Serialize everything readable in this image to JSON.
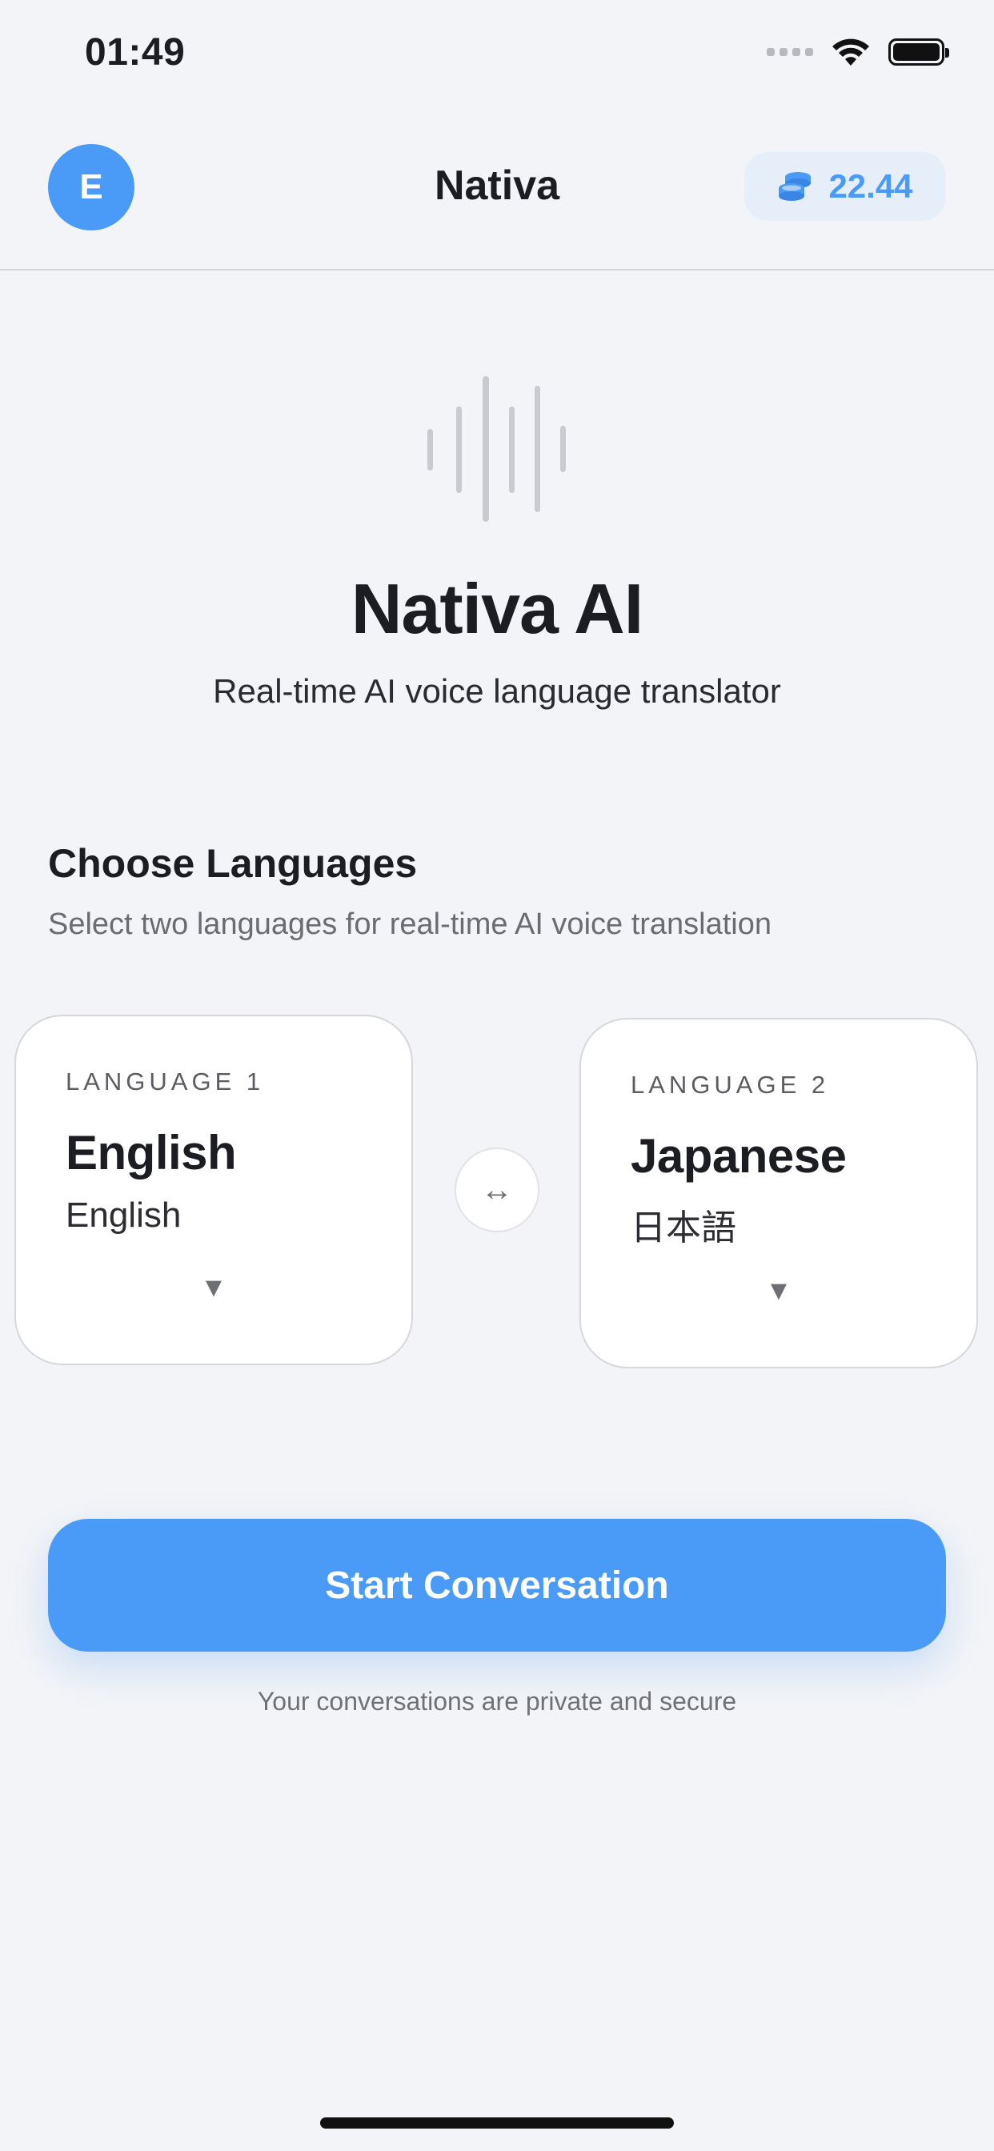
{
  "status_bar": {
    "time": "01:49",
    "signal_icon": "cellular-dots-icon",
    "wifi_icon": "wifi-icon",
    "battery_icon": "battery-icon"
  },
  "header": {
    "avatar_initial": "E",
    "title": "Nativa",
    "credits_icon": "coins-stack-icon",
    "credits_value": "22.44"
  },
  "hero": {
    "icon": "sound-wave-icon",
    "title": "Nativa AI",
    "subtitle": "Real-time AI voice language translator"
  },
  "languages_section": {
    "title": "Choose Languages",
    "subtitle": "Select two languages for real-time AI voice translation",
    "language_1": {
      "label": "LANGUAGE 1",
      "name": "English",
      "native_name": "English",
      "caret": "▼"
    },
    "language_2": {
      "label": "LANGUAGE 2",
      "name": "Japanese",
      "native_name": "日本語",
      "caret": "▼"
    },
    "swap_symbol": "↔"
  },
  "cta": {
    "start_label": "Start Conversation",
    "privacy_note": "Your conversations are private and secure"
  },
  "colors": {
    "accent": "#4a9bf8",
    "background": "#f3f4f7",
    "credits_bg": "#e6eef9"
  }
}
